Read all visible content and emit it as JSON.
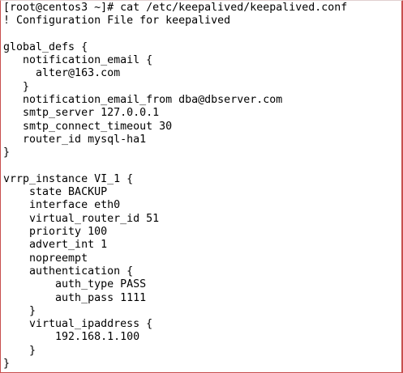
{
  "terminal": {
    "lines": [
      "[root@centos3 ~]# cat /etc/keepalived/keepalived.conf",
      "! Configuration File for keepalived",
      "",
      "global_defs {",
      "   notification_email {",
      "     alter@163.com",
      "   }",
      "   notification_email_from dba@dbserver.com",
      "   smtp_server 127.0.0.1",
      "   smtp_connect_timeout 30",
      "   router_id mysql-ha1",
      "}",
      "",
      "vrrp_instance VI_1 {",
      "    state BACKUP",
      "    interface eth0",
      "    virtual_router_id 51",
      "    priority 100",
      "    advert_int 1",
      "    nopreempt",
      "    authentication {",
      "        auth_type PASS",
      "        auth_pass 1111",
      "    }",
      "    virtual_ipaddress {",
      "        192.168.1.100",
      "    }",
      "}"
    ]
  }
}
